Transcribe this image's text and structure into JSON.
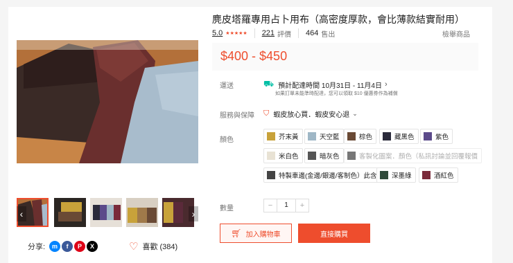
{
  "product": {
    "title": "麂皮塔羅專用占卜用布（高密度厚款，會比薄款結實耐用）",
    "rating": "5.0",
    "reviews_count": "221",
    "reviews_label": "評價",
    "sold_count": "464",
    "sold_label": "售出",
    "report_label": "檢舉商品",
    "price": "$400 - $450",
    "rating_stars": 5
  },
  "shipping": {
    "label": "運送",
    "estimate": "預計配達時間 10月31日 - 11月4日",
    "note": "如果訂單未能準時配達，您可以領取 $10 優惠券作為補償"
  },
  "assurance": {
    "label": "服務與保障",
    "text": "蝦皮放心買．蝦皮安心退"
  },
  "colors": {
    "label": "顏色",
    "options": [
      {
        "label": "芥末黃",
        "swatch": "#c8a23a"
      },
      {
        "label": "天空藍",
        "swatch": "#9fb7c6"
      },
      {
        "label": "棕色",
        "swatch": "#6a4a35"
      },
      {
        "label": "藏黑色",
        "swatch": "#2a2a3a"
      },
      {
        "label": "紫色",
        "swatch": "#5b4a8a"
      },
      {
        "label": "米白色",
        "swatch": "#e8e2d4"
      },
      {
        "label": "暗灰色",
        "swatch": "#555"
      },
      {
        "label": "客製化圖案．顏色（私訊討論並回覆報價",
        "swatch": "#777"
      },
      {
        "label": "特製車邊(金邊/銀邊/客制色）此含布",
        "swatch": "#444"
      },
      {
        "label": "深墨綠",
        "swatch": "#2f4a3a"
      },
      {
        "label": "酒紅色",
        "swatch": "#7a2a3a"
      }
    ]
  },
  "quantity": {
    "label": "數量",
    "value": "1",
    "minus": "−",
    "plus": "+"
  },
  "actions": {
    "add_to_cart": "加入購物車",
    "buy_now": "直接購買"
  },
  "share": {
    "label": "分享:",
    "icons": [
      "messenger-icon",
      "facebook-icon",
      "pinterest-icon",
      "x-icon"
    ]
  },
  "like": {
    "text": "喜歡 (384)"
  },
  "colors_theme": {
    "accent": "#ee4d2d"
  }
}
